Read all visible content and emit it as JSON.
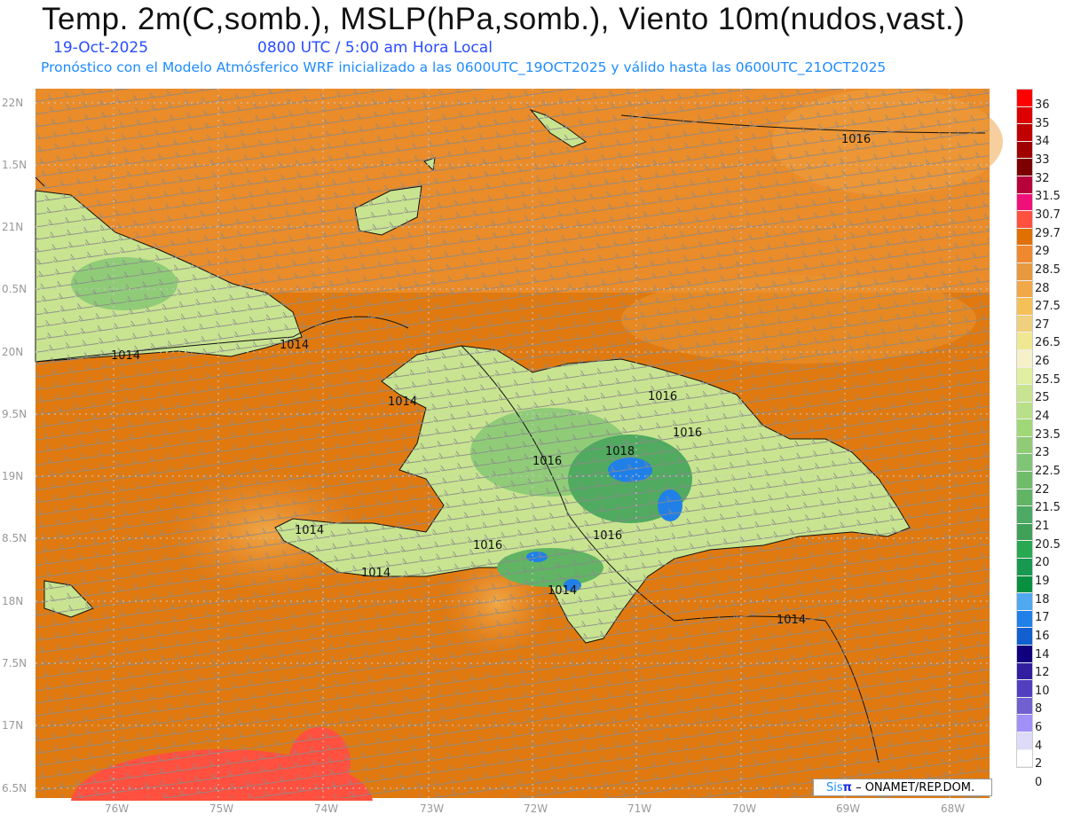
{
  "header": {
    "title": "Temp. 2m(C,somb.), MSLP(hPa,somb.), Viento 10m(nudos,vast.)",
    "date": "19-Oct-2025",
    "time": "0800 UTC / 5:00 am Hora Local",
    "forecast": "Pronóstico con el Modelo Atmósferico WRF inicializado a las 0600UTC_19OCT2025 y válido hasta las  0600UTC_21OCT2025"
  },
  "axes": {
    "lon_labels": [
      "76W",
      "75W",
      "74W",
      "73W",
      "72W",
      "71W",
      "70W",
      "69W",
      "68W"
    ],
    "lat_labels": [
      "22N",
      "1.5N",
      "21N",
      "0.5N",
      "20N",
      "9.5N",
      "19N",
      "8.5N",
      "18N",
      "7.5N",
      "17N",
      "6.5N"
    ]
  },
  "isobars": [
    "1016",
    "1014",
    "1014",
    "1014",
    "1016",
    "1016",
    "1016",
    "1018",
    "1014",
    "1016",
    "1016",
    "1014",
    "1014",
    "1014"
  ],
  "colorbar": {
    "labels": [
      "36",
      "35",
      "34",
      "33",
      "32",
      "31.5",
      "30.7",
      "29.7",
      "29",
      "28.5",
      "28",
      "27.5",
      "27",
      "26.5",
      "26",
      "25.5",
      "25",
      "24",
      "23.5",
      "23",
      "22.5",
      "22",
      "21.5",
      "21",
      "20.5",
      "20",
      "19",
      "18",
      "17",
      "16",
      "14",
      "12",
      "10",
      "8",
      "6",
      "4",
      "2",
      "0"
    ],
    "colors": [
      "#ff0000",
      "#dc0000",
      "#c00000",
      "#a00000",
      "#7c0000",
      "#b8003c",
      "#f0107a",
      "#ff5040",
      "#e07000",
      "#f08830",
      "#e89840",
      "#f0a848",
      "#f5c058",
      "#f0d07c",
      "#f0e890",
      "#f5f0c8",
      "#e0f0a0",
      "#c8e490",
      "#b8e088",
      "#a0d878",
      "#90cc78",
      "#80c478",
      "#70bc6c",
      "#60b464",
      "#4caa64",
      "#40a058",
      "#28a850",
      "#189850",
      "#089040",
      "#50a8f0",
      "#2080e8",
      "#1060d0",
      "#100080",
      "#3020a0",
      "#5040c0",
      "#7060d0",
      "#a090f8",
      "#dcdcf8",
      "#ffffff"
    ]
  },
  "credit": {
    "sis": "Sis",
    "pi": "π",
    "rest": " –  ONAMET/REP.DOM."
  }
}
